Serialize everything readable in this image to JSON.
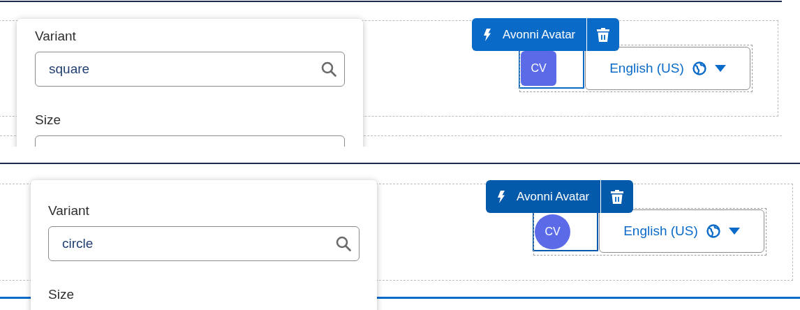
{
  "panels": [
    {
      "avatar": {
        "initials": "CV",
        "kind": "square"
      },
      "toolbar": {
        "label": "Avonni Avatar"
      },
      "language": {
        "label": "English (US)"
      },
      "popover": {
        "variant": {
          "label": "Variant",
          "value": "square"
        },
        "size": {
          "label": "Size"
        }
      }
    },
    {
      "avatar": {
        "initials": "CV",
        "kind": "circle"
      },
      "toolbar": {
        "label": "Avonni Avatar"
      },
      "language": {
        "label": "English (US)"
      },
      "popover": {
        "variant": {
          "label": "Variant",
          "value": "circle"
        },
        "size": {
          "label": "Size"
        }
      }
    }
  ]
}
